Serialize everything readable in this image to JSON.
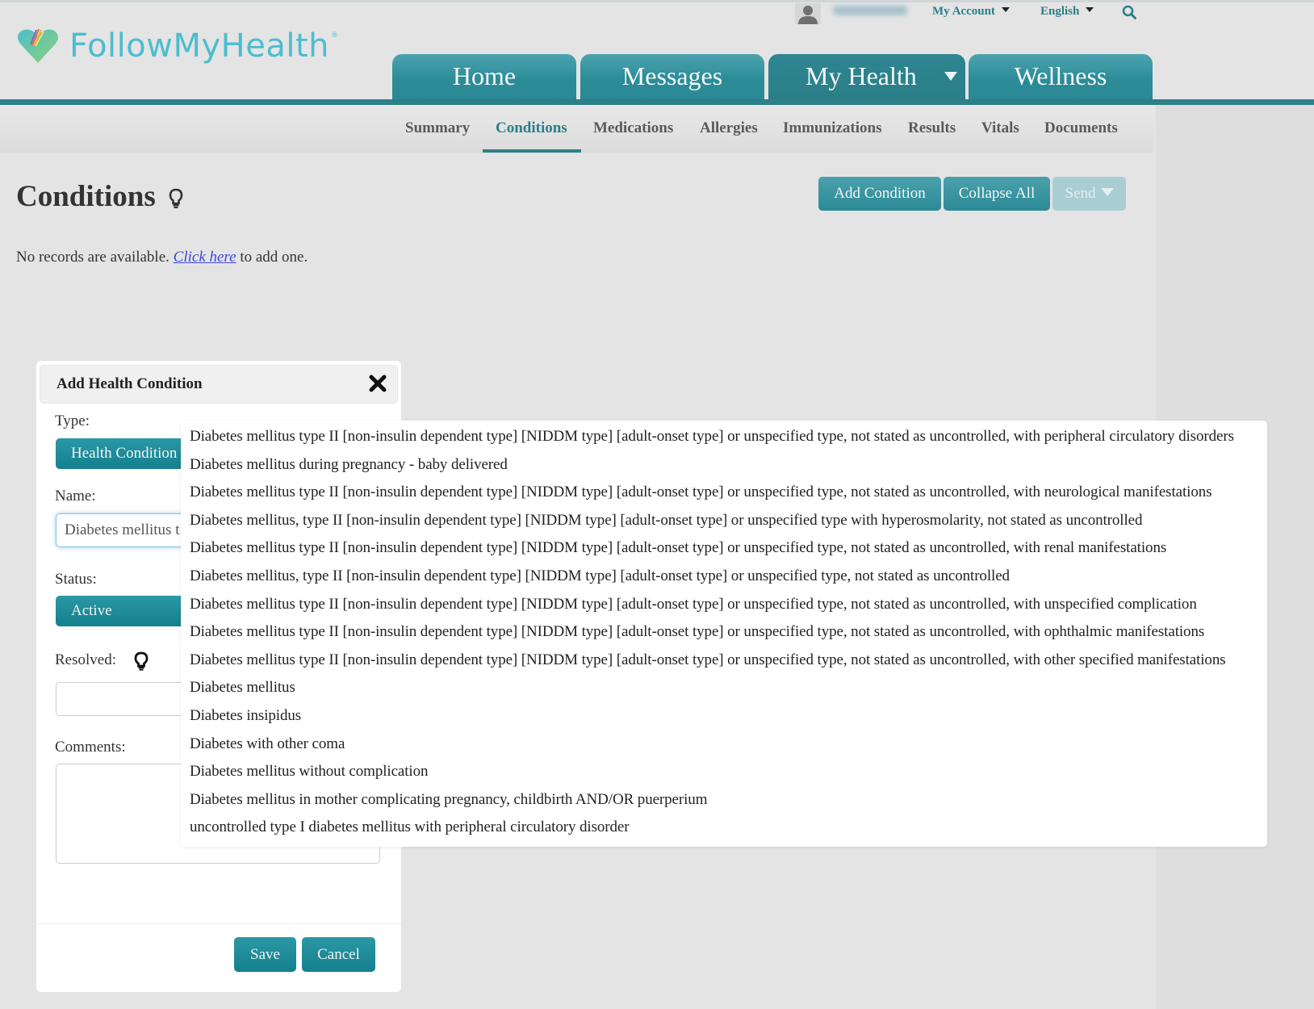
{
  "utility_bar": {
    "username": "",
    "my_account": "My Account",
    "language": "English"
  },
  "brand": {
    "name": "FollowMyHealth",
    "registered_mark": "®",
    "colors": {
      "logo": "#4bbdd0",
      "teal": "#2b8c98",
      "teal_dark": "#2e7f88"
    }
  },
  "main_tabs": [
    {
      "label": "Home",
      "active": false
    },
    {
      "label": "Messages",
      "active": false
    },
    {
      "label": "My Health",
      "active": true
    },
    {
      "label": "Wellness",
      "active": false
    }
  ],
  "sub_nav": [
    {
      "label": "Summary",
      "active": false
    },
    {
      "label": "Conditions",
      "active": true
    },
    {
      "label": "Medications",
      "active": false
    },
    {
      "label": "Allergies",
      "active": false
    },
    {
      "label": "Immunizations",
      "active": false
    },
    {
      "label": "Results",
      "active": false
    },
    {
      "label": "Vitals",
      "active": false
    },
    {
      "label": "Documents",
      "active": false
    }
  ],
  "page": {
    "title": "Conditions",
    "add_condition": "Add Condition",
    "collapse_all": "Collapse All",
    "send": "Send",
    "empty_prefix": "No records are available. ",
    "empty_link": "Click here",
    "empty_suffix": " to add one."
  },
  "dialog": {
    "title": "Add Health Condition",
    "type_label": "Type:",
    "type_value": "Health Condition",
    "name_label": "Name:",
    "name_value": "Diabetes mellitus t",
    "status_label": "Status:",
    "status_value": "Active",
    "resolved_label": "Resolved:",
    "resolved_value": "",
    "comments_label": "Comments:",
    "comments_value": "",
    "save": "Save",
    "cancel": "Cancel"
  },
  "suggestions": [
    "Diabetes mellitus type II [non-insulin dependent type] [NIDDM type] [adult-onset type] or unspecified type, not stated as uncontrolled, with peripheral circulatory disorders",
    "Diabetes mellitus during pregnancy - baby delivered",
    "Diabetes mellitus type II [non-insulin dependent type] [NIDDM type] [adult-onset type] or unspecified type, not stated as uncontrolled, with neurological manifestations",
    "Diabetes mellitus, type II [non-insulin dependent type] [NIDDM type] [adult-onset type] or unspecified type with hyperosmolarity, not stated as uncontrolled",
    "Diabetes mellitus type II [non-insulin dependent type] [NIDDM type] [adult-onset type] or unspecified type, not stated as uncontrolled, with renal manifestations",
    "Diabetes mellitus, type II [non-insulin dependent type] [NIDDM type] [adult-onset type] or unspecified type, not stated as uncontrolled",
    "Diabetes mellitus type II [non-insulin dependent type] [NIDDM type] [adult-onset type] or unspecified type, not stated as uncontrolled, with unspecified complication",
    "Diabetes mellitus type II [non-insulin dependent type] [NIDDM type] [adult-onset type] or unspecified type, not stated as uncontrolled, with ophthalmic manifestations",
    "Diabetes mellitus type II [non-insulin dependent type] [NIDDM type] [adult-onset type] or unspecified type, not stated as uncontrolled, with other specified manifestations",
    "Diabetes mellitus",
    "Diabetes insipidus",
    "Diabetes with other coma",
    "Diabetes mellitus without complication",
    "Diabetes mellitus in mother complicating pregnancy, childbirth AND/OR puerperium",
    "uncontrolled type I diabetes mellitus with peripheral circulatory disorder"
  ]
}
